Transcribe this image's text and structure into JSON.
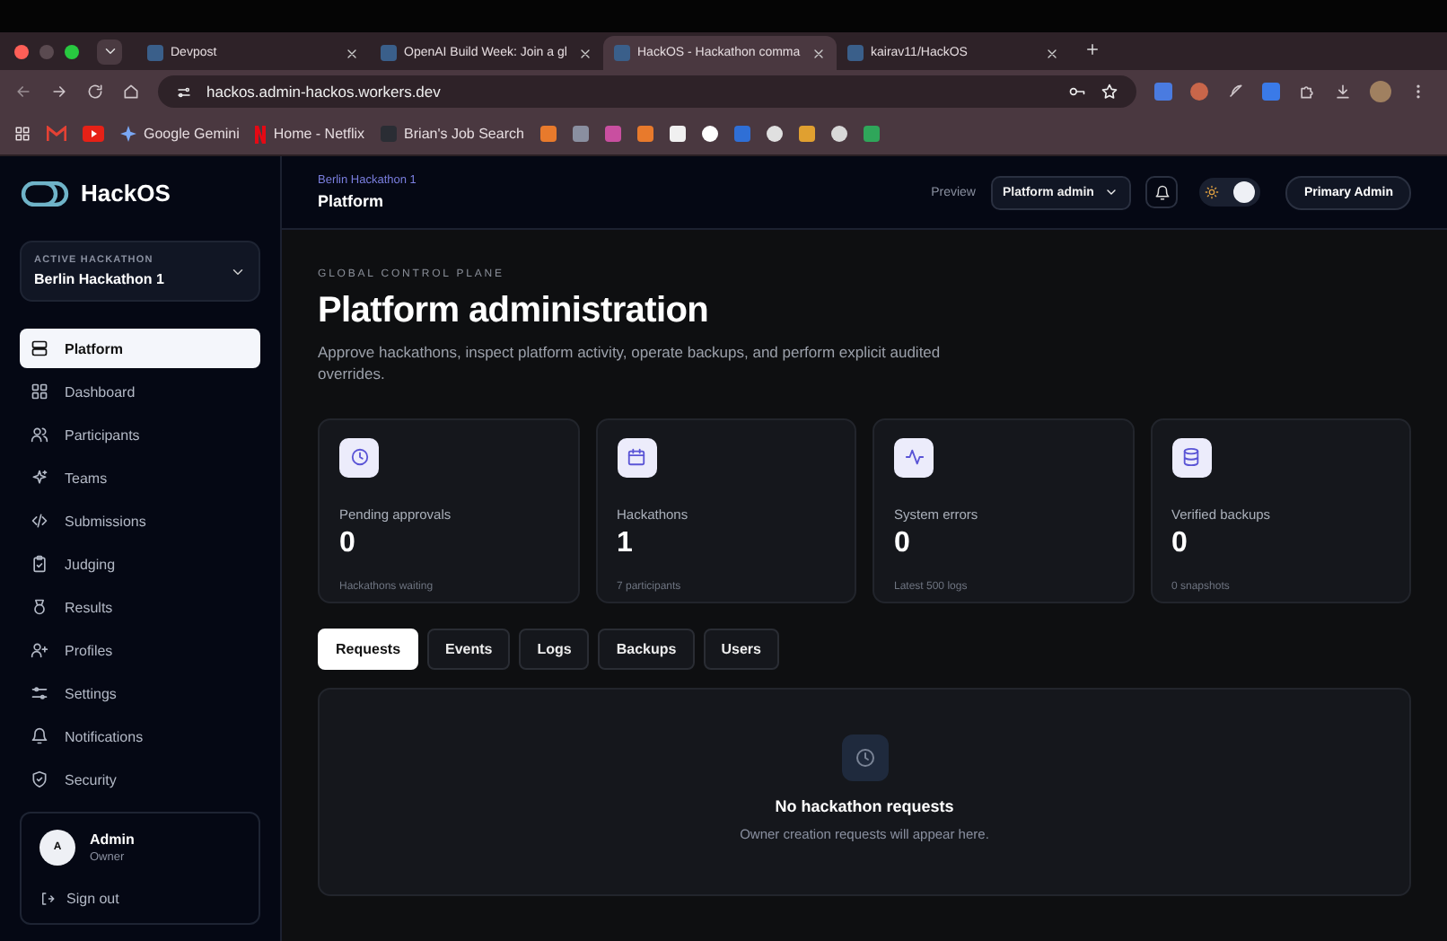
{
  "browser": {
    "tabs": [
      {
        "title": "Devpost",
        "selected": false
      },
      {
        "title": "OpenAI Build Week: Join a gl",
        "selected": false
      },
      {
        "title": "HackOS - Hackathon comma",
        "selected": true
      },
      {
        "title": "kairav11/HackOS",
        "selected": false
      }
    ],
    "url": "hackos.admin-hackos.workers.dev",
    "bookmarks": [
      {
        "kind": "gmail"
      },
      {
        "kind": "youtube"
      },
      {
        "kind": "star",
        "label": "Google Gemini"
      },
      {
        "kind": "netflix",
        "label": "Home - Netflix"
      },
      {
        "kind": "folder",
        "label": "Brian's Job Search"
      },
      {
        "kind": "tile",
        "color": "#e87a2c"
      },
      {
        "kind": "tile",
        "color": "#8a8fa0"
      },
      {
        "kind": "tile",
        "color": "#c94fa0"
      },
      {
        "kind": "tile",
        "color": "#e87a2c"
      },
      {
        "kind": "tile",
        "color": "#f0f0f0"
      },
      {
        "kind": "circle",
        "color": "#ffffff"
      },
      {
        "kind": "tile",
        "color": "#2f6fd6"
      },
      {
        "kind": "circle",
        "color": "#e0e0e0"
      },
      {
        "kind": "tile",
        "color": "#e0a030"
      },
      {
        "kind": "circle",
        "color": "#d8d8d8"
      },
      {
        "kind": "tile",
        "color": "#2fa65a"
      }
    ]
  },
  "sidebar": {
    "brand": "HackOS",
    "active_hackathon": {
      "label": "ACTIVE HACKATHON",
      "value": "Berlin Hackathon 1"
    },
    "items": [
      {
        "label": "Platform",
        "selected": true
      },
      {
        "label": "Dashboard",
        "selected": false
      },
      {
        "label": "Participants",
        "selected": false
      },
      {
        "label": "Teams",
        "selected": false
      },
      {
        "label": "Submissions",
        "selected": false
      },
      {
        "label": "Judging",
        "selected": false
      },
      {
        "label": "Results",
        "selected": false
      },
      {
        "label": "Profiles",
        "selected": false
      },
      {
        "label": "Settings",
        "selected": false
      },
      {
        "label": "Notifications",
        "selected": false
      },
      {
        "label": "Security",
        "selected": false
      }
    ],
    "user": {
      "initial": "A",
      "name": "Admin",
      "role": "Owner"
    },
    "sign_out": "Sign out"
  },
  "header": {
    "breadcrumb": "Berlin Hackathon 1",
    "title": "Platform",
    "preview_label": "Preview",
    "preview_value": "Platform admin",
    "theme_toggle": {
      "on": true
    },
    "account": "Primary Admin"
  },
  "page": {
    "eyebrow": "GLOBAL CONTROL PLANE",
    "title": "Platform administration",
    "description": "Approve hackathons, inspect platform activity, operate backups, and perform explicit audited overrides.",
    "stats": [
      {
        "label": "Pending approvals",
        "value": "0",
        "note": "Hackathons waiting"
      },
      {
        "label": "Hackathons",
        "value": "1",
        "note": "7 participants"
      },
      {
        "label": "System errors",
        "value": "0",
        "note": "Latest 500 logs"
      },
      {
        "label": "Verified backups",
        "value": "0",
        "note": "0 snapshots"
      }
    ],
    "tabs": [
      {
        "label": "Requests",
        "selected": true
      },
      {
        "label": "Events",
        "selected": false
      },
      {
        "label": "Logs",
        "selected": false
      },
      {
        "label": "Backups",
        "selected": false
      },
      {
        "label": "Users",
        "selected": false
      }
    ],
    "empty": {
      "title": "No hackathon requests",
      "text": "Owner creation requests will appear here."
    }
  }
}
